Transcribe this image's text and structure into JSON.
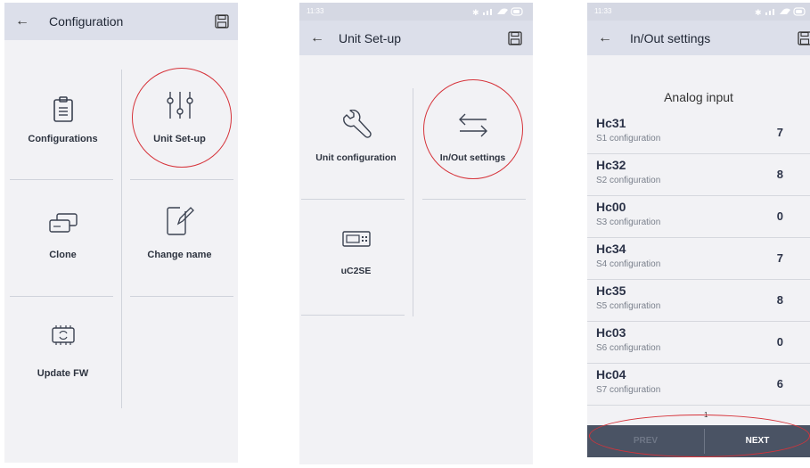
{
  "screen1": {
    "title": "Configuration",
    "tiles": [
      {
        "label": "Configurations",
        "icon": "clipboard-icon"
      },
      {
        "label": "Unit Set-up",
        "icon": "sliders-icon"
      },
      {
        "label": "Clone",
        "icon": "clone-devices-icon"
      },
      {
        "label": "Change name",
        "icon": "edit-document-icon"
      },
      {
        "label": "Update FW",
        "icon": "firmware-chip-icon"
      }
    ]
  },
  "screen2": {
    "status_time": "11:33",
    "title": "Unit Set-up",
    "tiles": [
      {
        "label": "Unit configuration",
        "icon": "wrench-icon"
      },
      {
        "label": "In/Out settings",
        "icon": "swap-arrows-icon"
      },
      {
        "label": "uC2SE",
        "icon": "controller-device-icon"
      }
    ]
  },
  "screen3": {
    "status_time": "11:33",
    "title": "In/Out settings",
    "section_title": "Analog input",
    "rows": [
      {
        "code": "Hc31",
        "desc": "S1 configuration",
        "value": "7"
      },
      {
        "code": "Hc32",
        "desc": "S2 configuration",
        "value": "8"
      },
      {
        "code": "Hc00",
        "desc": "S3 configuration",
        "value": "0"
      },
      {
        "code": "Hc34",
        "desc": "S4 configuration",
        "value": "7"
      },
      {
        "code": "Hc35",
        "desc": "S5 configuration",
        "value": "8"
      },
      {
        "code": "Hc03",
        "desc": "S6 configuration",
        "value": "0"
      },
      {
        "code": "Hc04",
        "desc": "S7 configuration",
        "value": "6"
      }
    ],
    "page_number": "1",
    "prev_label": "PREV",
    "next_label": "NEXT"
  },
  "colors": {
    "appbar": "#dcdfea",
    "background": "#f2f2f5",
    "highlight": "#d6333a",
    "pager": "#4a5364"
  }
}
